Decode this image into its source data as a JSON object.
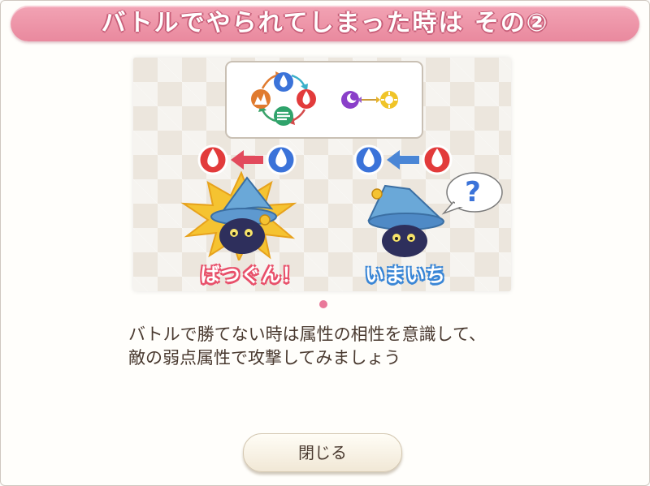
{
  "dialog": {
    "title": "バトルでやられてしまった時は その②",
    "body_line1": "バトルで勝てない時は属性の相性を意識して、",
    "body_line2": "敵の弱点属性で攻撃してみましょう",
    "close_label": "閉じる"
  },
  "illustration": {
    "good_caption": "ばつぐん！",
    "bad_caption": "いまいち",
    "question_mark": "?",
    "arrow_both": "↔"
  },
  "pagination": {
    "current": 1,
    "total": 1
  },
  "colors": {
    "title_pink": "#e9899e",
    "fire": "#e23b3b",
    "water": "#3b73d9",
    "earth": "#e07a2e",
    "wind": "#2fa36b",
    "dark": "#8a3fc9",
    "light": "#f0c428",
    "good_text": "#e8506a",
    "bad_text": "#3a86d6"
  }
}
